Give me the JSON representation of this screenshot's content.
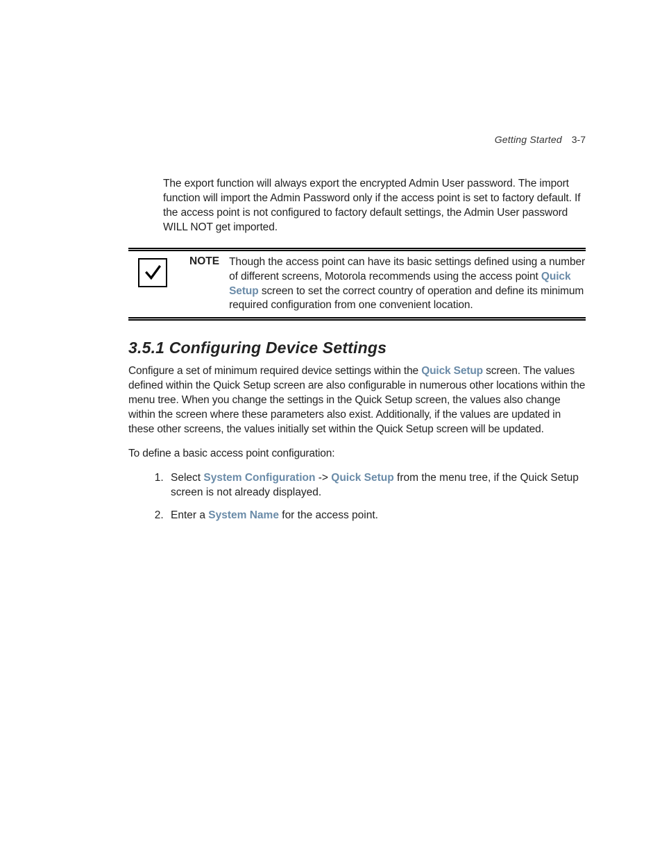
{
  "header": {
    "title": "Getting Started",
    "page": "3-7"
  },
  "intro_paragraph": "The export function will always export the encrypted Admin User password. The import function will import the Admin Password only if the access point is set to factory default. If the access point is not configured to factory default settings, the Admin User password WILL NOT get imported.",
  "note": {
    "label": "NOTE",
    "body_pre": "Though the access point can have its basic settings defined using a number of different screens, Motorola recommends using the access point ",
    "keyword": "Quick Setup",
    "body_post": " screen to set the correct country of operation and define its minimum required configuration from one convenient location."
  },
  "section": {
    "heading": "3.5.1  Configuring Device Settings",
    "para1_pre": "Configure a set of minimum required device settings within the ",
    "para1_kw": "Quick Setup",
    "para1_post": " screen. The values defined within the Quick Setup screen are also configurable in numerous other locations within the menu tree. When you change the settings in the Quick Setup screen, the values also change within the screen where these parameters also exist. Additionally, if the values are updated in these other screens, the values initially set within the Quick Setup screen will be updated.",
    "para2": "To define a basic access point configuration:",
    "steps": {
      "s1_pre": "Select ",
      "s1_kw1": "System Configuration",
      "s1_mid": " -> ",
      "s1_kw2": "Quick Setup",
      "s1_post": " from the menu tree, if the Quick Setup screen is not already displayed.",
      "s2_pre": "Enter a ",
      "s2_kw": "System Name",
      "s2_post": " for the access point."
    }
  }
}
